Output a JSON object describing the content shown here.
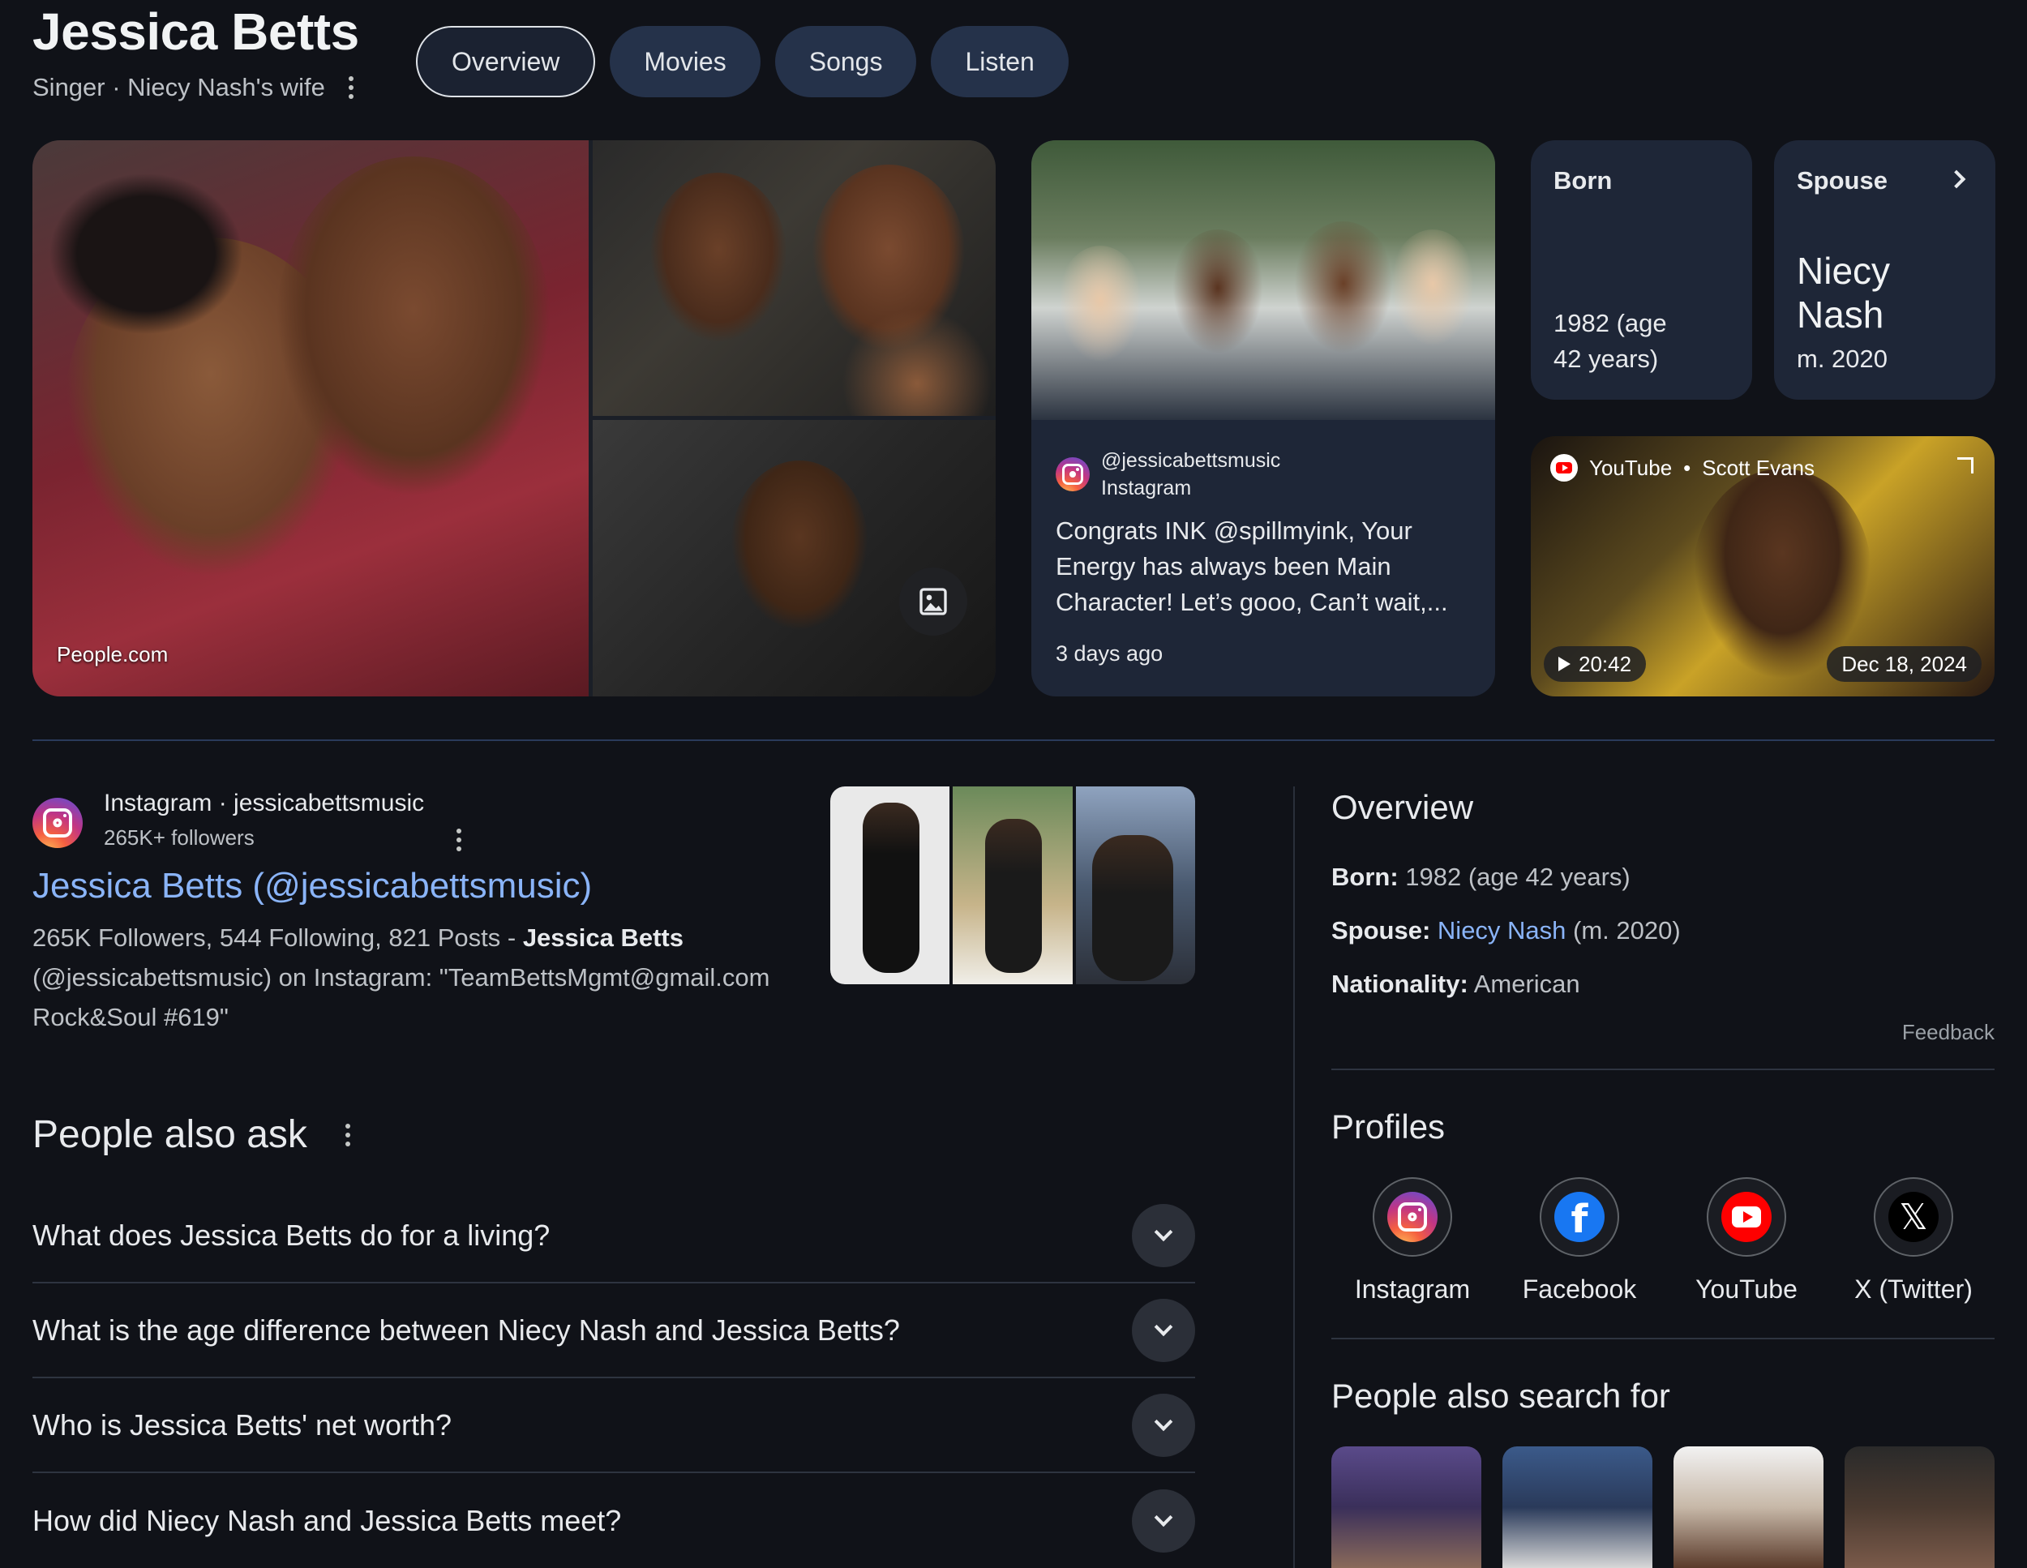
{
  "header": {
    "title": "Jessica Betts",
    "subtitle": "Singer · Niecy Nash's wife",
    "tabs": [
      {
        "label": "Overview",
        "active": true
      },
      {
        "label": "Movies",
        "active": false
      },
      {
        "label": "Songs",
        "active": false
      },
      {
        "label": "Listen",
        "active": false
      }
    ]
  },
  "images": {
    "source": "People.com"
  },
  "post": {
    "handle": "@jessicabettsmusic",
    "platform": "Instagram",
    "text": "Congrats INK @spillmyink, Your Energy has always been Main Character! Let’s gooo, Can’t wait,...",
    "time": "3 days ago"
  },
  "born_tile": {
    "label": "Born",
    "value_line1": "1982 (age",
    "value_line2": "42 years)"
  },
  "spouse_tile": {
    "label": "Spouse",
    "name_line1": "Niecy",
    "name_line2": "Nash",
    "married": "m. 2020"
  },
  "video": {
    "source": "YouTube",
    "channel": "Scott Evans",
    "duration": "20:42",
    "date": "Dec 18, 2024"
  },
  "result": {
    "site": "Instagram · jessicabettsmusic",
    "followers": "265K+ followers",
    "title": "Jessica Betts (@jessicabettsmusic)",
    "snippet_prefix": "265K Followers, 544 Following, 821 Posts - ",
    "snippet_bold": "Jessica Betts",
    "snippet_suffix": " (@jessicabettsmusic) on Instagram: \"TeamBettsMgmt@gmail.com Rock&Soul #619\""
  },
  "paa": {
    "title": "People also ask",
    "questions": [
      "What does Jessica Betts do for a living?",
      "What is the age difference between Niecy Nash and Jessica Betts?",
      "Who is Jessica Betts' net worth?",
      "How did Niecy Nash and Jessica Betts meet?"
    ]
  },
  "overview": {
    "title": "Overview",
    "born_label": "Born:",
    "born_value": " 1982 (age 42 years)",
    "spouse_label": "Spouse:",
    "spouse_link": "Niecy Nash",
    "spouse_suffix": " (m. 2020)",
    "nationality_label": "Nationality:",
    "nationality_value": " American",
    "feedback": "Feedback"
  },
  "profiles": {
    "title": "Profiles",
    "items": [
      "Instagram",
      "Facebook",
      "YouTube",
      "X (Twitter)"
    ]
  },
  "people_also_search": {
    "title": "People also search for"
  },
  "colors": {
    "background": "#101218",
    "card": "#1e2637",
    "link": "#8ab4f8",
    "chip": "#25324a"
  }
}
